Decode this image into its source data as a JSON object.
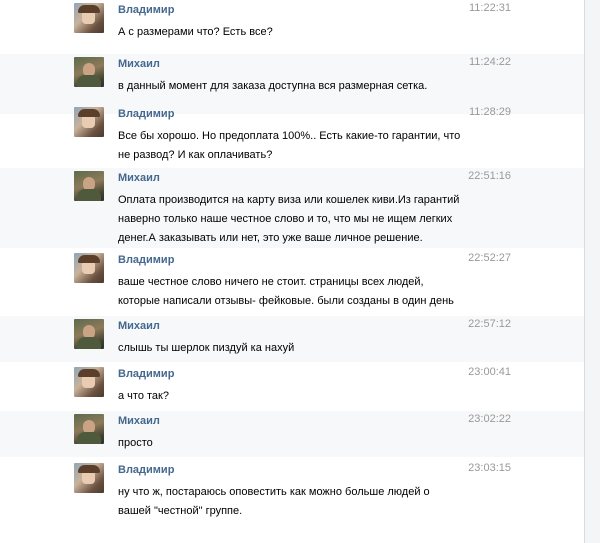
{
  "messages": [
    {
      "author": "Владимир",
      "time": "11:22:31",
      "lines": [
        "А с размерами что? Есть все?"
      ]
    },
    {
      "author": "Михаил",
      "time": "11:24:22",
      "lines": [
        "в данный момент для заказа доступна вся размерная сетка."
      ]
    },
    {
      "author": "Владимир",
      "time": "11:28:29",
      "lines": [
        "Все бы хорошо. Но предоплата 100%.. Есть какие-то гарантии, что",
        "не развод? И как оплачивать?"
      ]
    },
    {
      "author": "Михаил",
      "time": "22:51:16",
      "lines": [
        "Оплата производится на карту виза или кошелек киви.Из гарантий",
        "наверно только наше честное слово и то, что мы не ищем легких",
        "денег.А заказывать или нет, это уже ваше личное решение."
      ]
    },
    {
      "author": "Владимир",
      "time": "22:52:27",
      "lines": [
        "ваше честное слово ничего не стоит. страницы всех людей,",
        "которые написали отзывы- фейковые. были созданы в один день"
      ]
    },
    {
      "author": "Михаил",
      "time": "22:57:12",
      "lines": [
        "слышь ты шерлок пиздуй ка нахуй"
      ]
    },
    {
      "author": "Владимир",
      "time": "23:00:41",
      "lines": [
        "а что так?"
      ]
    },
    {
      "author": "Михаил",
      "time": "23:02:22",
      "lines": [
        "просто"
      ]
    },
    {
      "author": "Владимир",
      "time": "23:03:15",
      "lines": [
        "ну что ж, постараюсь оповестить как можно больше людей о",
        "вашей \"честной\" группе."
      ]
    }
  ],
  "icons": {
    "vladimir_avatar": "avatar-photo-couple",
    "mikhail_avatar": "avatar-photo-man"
  },
  "colors": {
    "author": "#45688e",
    "time": "#999999",
    "highlight": "#f7f8fa"
  }
}
